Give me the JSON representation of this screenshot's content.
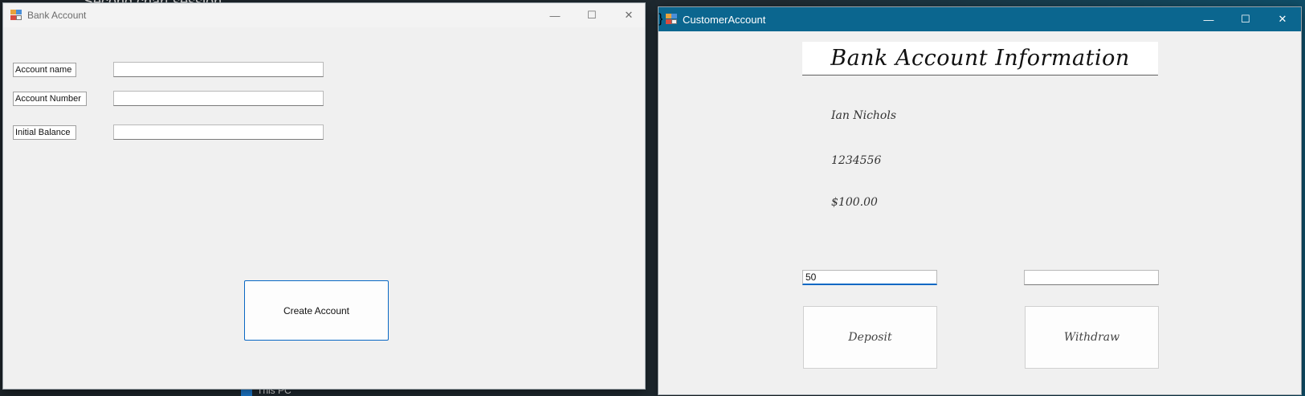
{
  "background": {
    "top_text": "Second chart session",
    "bottom_text": "This PC"
  },
  "bank_account_window": {
    "title": "Bank Account",
    "controls": {
      "minimize": "—",
      "maximize": "☐",
      "close": "✕"
    },
    "fields": [
      {
        "label": "Account name",
        "value": ""
      },
      {
        "label": "Account Number",
        "value": ""
      },
      {
        "label": "Initial Balance",
        "value": ""
      }
    ],
    "create_button_label": "Create Account"
  },
  "customer_account_window": {
    "title": "CustomerAccount",
    "controls": {
      "minimize": "—",
      "maximize": "☐",
      "close": "✕"
    },
    "header": "Bank Account Information",
    "account_name": "Ian Nichols",
    "account_number": "1234556",
    "balance": "$100.00",
    "deposit_amount": "50",
    "withdraw_amount": "",
    "deposit_button_label": "Deposit",
    "withdraw_button_label": "Withdraw"
  },
  "colors": {
    "title_bar_active": "#0b668f",
    "window_bg": "#f0f0f0",
    "focus_border": "#0a68c4"
  }
}
